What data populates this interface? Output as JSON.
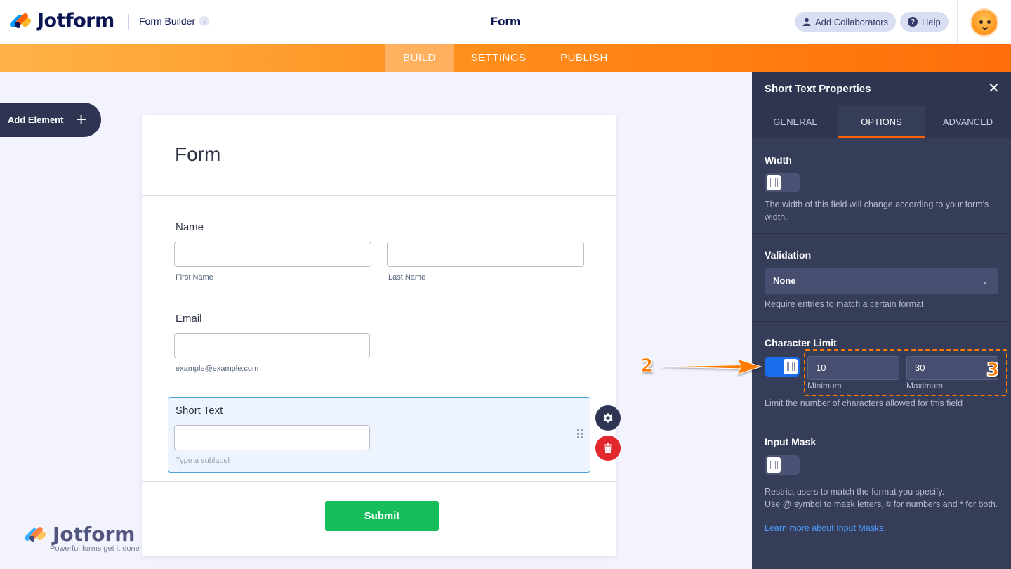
{
  "header": {
    "logo_text": "Jotform",
    "builder_label": "Form Builder",
    "form_title": "Form",
    "collaborators_label": "Add Collaborators",
    "help_label": "Help",
    "help_glyph": "?"
  },
  "nav": {
    "tabs": [
      {
        "label": "BUILD",
        "active": true
      },
      {
        "label": "SETTINGS",
        "active": false
      },
      {
        "label": "PUBLISH",
        "active": false
      }
    ]
  },
  "sidebar": {
    "add_element_label": "Add Element"
  },
  "form": {
    "title": "Form",
    "name_field": {
      "label": "Name",
      "first_sublabel": "First Name",
      "last_sublabel": "Last Name"
    },
    "email_field": {
      "label": "Email",
      "sublabel": "example@example.com"
    },
    "short_text_field": {
      "label": "Short Text",
      "sublabel_placeholder": "Type a sublabel"
    },
    "submit_label": "Submit"
  },
  "watermark": {
    "text": "Jotform",
    "tagline": "Powerful forms get it done"
  },
  "panel": {
    "title": "Short Text Properties",
    "close_glyph": "✕",
    "tabs": [
      {
        "label": "GENERAL",
        "active": false
      },
      {
        "label": "OPTIONS",
        "active": true
      },
      {
        "label": "ADVANCED",
        "active": false
      }
    ],
    "width": {
      "title": "Width",
      "enabled": false,
      "description": "The width of this field will change according to your form's width."
    },
    "validation": {
      "title": "Validation",
      "selected": "None",
      "description": "Require entries to match a certain format"
    },
    "character_limit": {
      "title": "Character Limit",
      "enabled": true,
      "minimum": "10",
      "minimum_label": "Minimum",
      "maximum": "30",
      "maximum_label": "Maximum",
      "description": "Limit the number of characters allowed for this field"
    },
    "input_mask": {
      "title": "Input Mask",
      "enabled": false,
      "description_1": "Restrict users to match the format you specify.",
      "description_2": "Use @ symbol to mask letters, # for numbers and * for both.",
      "link_text": "Learn more about Input Masks",
      "link_suffix": "."
    }
  },
  "annotations": {
    "step_2": "2",
    "step_3": "3"
  },
  "colors": {
    "accent_orange": "#ff6100",
    "nav_gradient_start": "#ffb347",
    "nav_gradient_end": "#ff6d0a",
    "panel_bg": "#363d58",
    "toggle_on": "#1a6ded",
    "submit_green": "#18bd5b",
    "delete_red": "#e0282d",
    "selected_field_border": "#4aa4d9"
  }
}
